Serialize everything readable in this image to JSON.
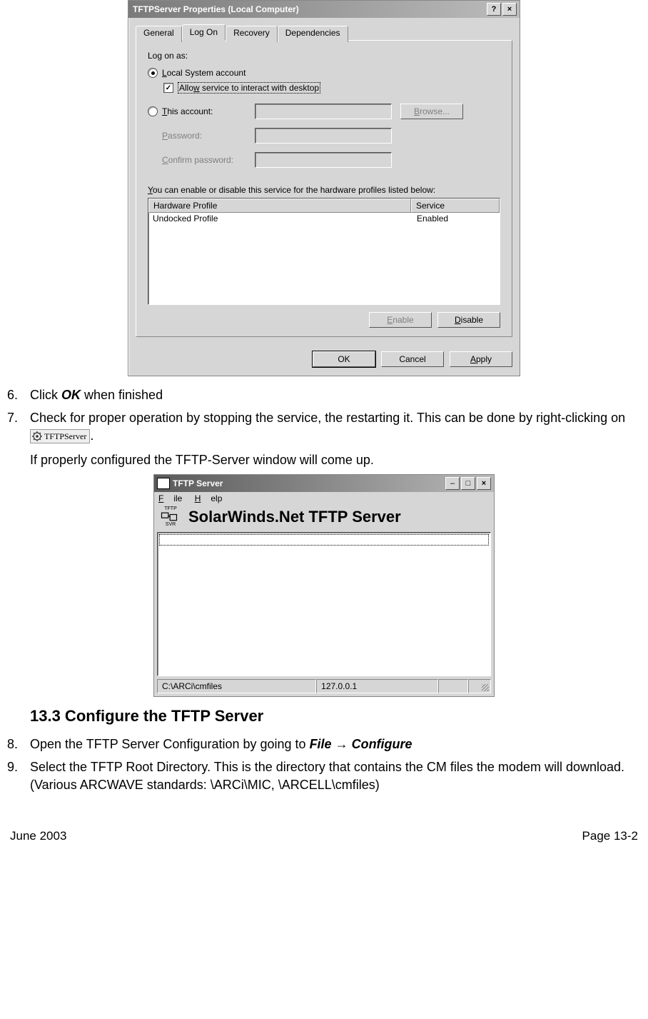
{
  "dialog1": {
    "title": "TFTPServer Properties (Local Computer)",
    "help": "?",
    "close": "×",
    "tabs": [
      "General",
      "Log On",
      "Recovery",
      "Dependencies"
    ],
    "active_tab_index": 1,
    "log_on_as_label": "Log on as:",
    "local_system_label": "Local System account",
    "allow_interact_label": "Allow service to interact with desktop",
    "this_account_label": "This account:",
    "browse_label": "Browse...",
    "password_label": "Password:",
    "confirm_password_label": "Confirm password:",
    "hw_profiles_label": "You can enable or disable this service for the hardware profiles listed below:",
    "lv_col1": "Hardware Profile",
    "lv_col2": "Service",
    "lv_row1_c1": "Undocked Profile",
    "lv_row1_c2": "Enabled",
    "enable_label": "Enable",
    "disable_label": "Disable",
    "ok_label": "OK",
    "cancel_label": "Cancel",
    "apply_label": "Apply"
  },
  "steps": {
    "s6_num": "6.",
    "s6_a": "Click ",
    "s6_b": "OK",
    "s6_c": " when finished",
    "s7_num": "7.",
    "s7_a": "Check for proper operation by stopping the service, the restarting it.  This can be done by right-clicking on ",
    "s7_icon_label": "TFTPServer",
    "s7_b": ".",
    "s7_c": "If properly configured the TFTP-Server window will come up.",
    "s8_num": "8.",
    "s8_a": "Open the TFTP Server Configuration by going to ",
    "s8_b": "File → Configure",
    "s9_num": "9.",
    "s9_a": "Select the TFTP Root Directory.  This is the directory that contains the CM files the modem will download.  (Various ARCWAVE standards: \\ARCi\\MIC, \\ARCELL\\cmfiles)"
  },
  "dialog2": {
    "title": "TFTP Server",
    "menu_file": "File",
    "menu_help": "Help",
    "logo_top": "TFTP",
    "logo_bot": "SVR",
    "banner": "SolarWinds.Net TFTP Server",
    "status_path": "C:\\ARCi\\cmfiles",
    "status_ip": "127.0.0.1",
    "min": "_",
    "max": "□",
    "close": "×"
  },
  "section_title": "13.3  Configure the TFTP Server",
  "footer": {
    "left": "June 2003",
    "right": "Page 13-2"
  }
}
